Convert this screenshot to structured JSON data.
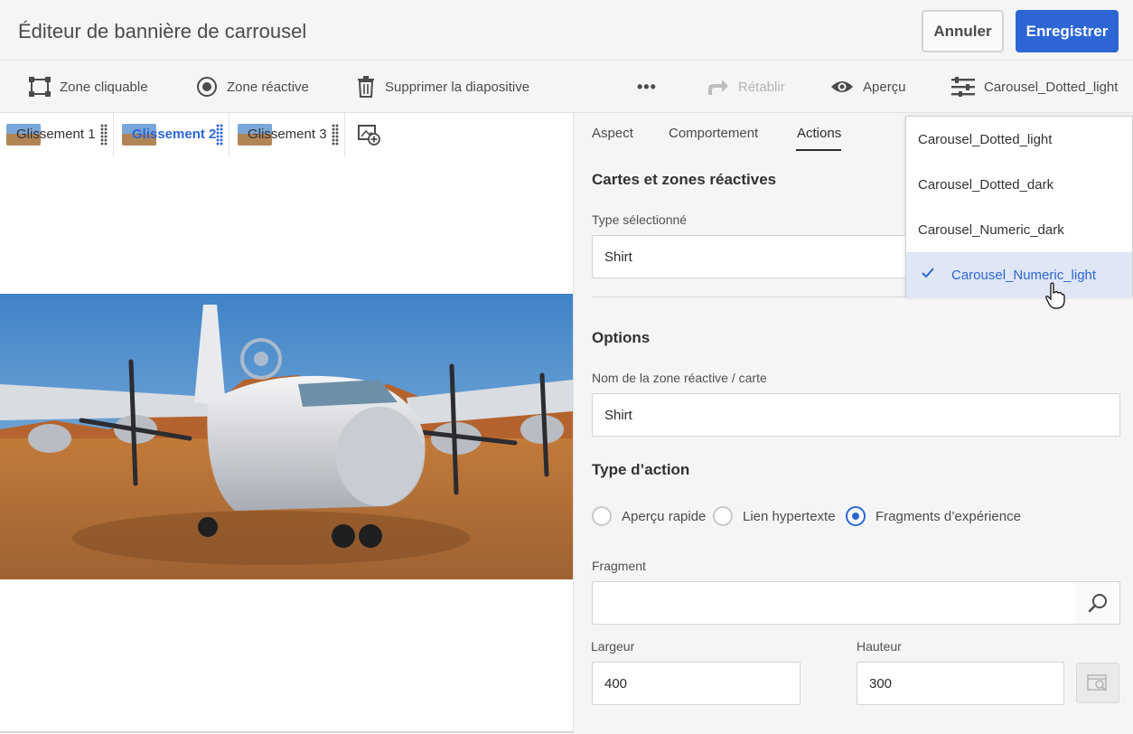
{
  "header": {
    "title": "Éditeur de bannière de carrousel",
    "cancel_label": "Annuler",
    "save_label": "Enregistrer"
  },
  "toolbar": {
    "clickable_zone": "Zone cliquable",
    "hotspot": "Zone réactive",
    "delete_slide": "Supprimer la diapositive",
    "more": "•••",
    "redo": "Rétablir",
    "preview": "Aperçu",
    "preset": "Carousel_Dotted_light"
  },
  "slides": [
    {
      "label": "Glissement 1",
      "active": false
    },
    {
      "label": "Glissement 2",
      "active": true
    },
    {
      "label": "Glissement 3",
      "active": false
    }
  ],
  "panel": {
    "tabs": [
      "Aspect",
      "Comportement",
      "Actions"
    ],
    "active_tab": "Actions",
    "maps_section": "Cartes et zones réactives",
    "selected_type_label": "Type sélectionné",
    "selected_type_value": "Shirt",
    "options_section": "Options",
    "name_label": "Nom de la zone réactive / carte",
    "name_value": "Shirt",
    "action_type_section": "Type d’action",
    "radios": [
      {
        "label": "Aperçu rapide",
        "checked": false
      },
      {
        "label": "Lien hypertexte",
        "checked": false
      },
      {
        "label": "Fragments d’expérience",
        "checked": true
      }
    ],
    "fragment_label": "Fragment",
    "fragment_value": "",
    "width_label": "Largeur",
    "width_value": "400",
    "height_label": "Hauteur",
    "height_value": "300"
  },
  "dropdown": {
    "items": [
      {
        "label": "Carousel_Dotted_light",
        "selected": false
      },
      {
        "label": "Carousel_Dotted_dark",
        "selected": false
      },
      {
        "label": "Carousel_Numeric_dark",
        "selected": false
      },
      {
        "label": "Carousel_Numeric_light",
        "selected": true
      }
    ]
  },
  "colors": {
    "accent": "#2d66d4",
    "panel_bg": "#f5f5f5",
    "selected_bg": "#dfe6f4"
  }
}
